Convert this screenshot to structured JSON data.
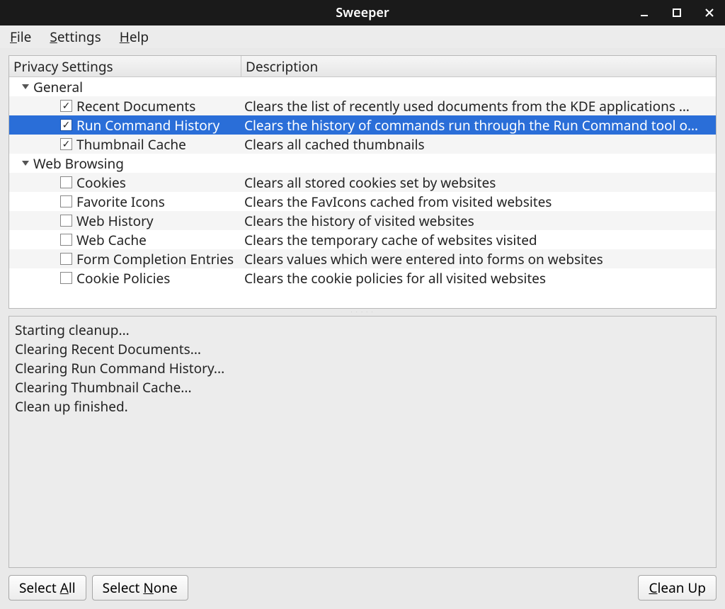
{
  "window": {
    "title": "Sweeper"
  },
  "menubar": {
    "file": "File",
    "settings": "Settings",
    "help": "Help"
  },
  "columns": {
    "col1": "Privacy Settings",
    "col2": "Description"
  },
  "groups": [
    {
      "name": "General",
      "items": [
        {
          "label": "Recent Documents",
          "checked": true,
          "selected": false,
          "desc": "Clears the list of recently used documents from the KDE applications …"
        },
        {
          "label": "Run Command History",
          "checked": true,
          "selected": true,
          "desc": "Clears the history of commands run through the Run Command tool o…"
        },
        {
          "label": "Thumbnail Cache",
          "checked": true,
          "selected": false,
          "desc": "Clears all cached thumbnails"
        }
      ]
    },
    {
      "name": "Web Browsing",
      "items": [
        {
          "label": "Cookies",
          "checked": false,
          "selected": false,
          "desc": "Clears all stored cookies set by websites"
        },
        {
          "label": "Favorite Icons",
          "checked": false,
          "selected": false,
          "desc": "Clears the FavIcons cached from visited websites"
        },
        {
          "label": "Web History",
          "checked": false,
          "selected": false,
          "desc": "Clears the history of visited websites"
        },
        {
          "label": "Web Cache",
          "checked": false,
          "selected": false,
          "desc": "Clears the temporary cache of websites visited"
        },
        {
          "label": "Form Completion Entries",
          "checked": false,
          "selected": false,
          "desc": "Clears values which were entered into forms on websites"
        },
        {
          "label": "Cookie Policies",
          "checked": false,
          "selected": false,
          "desc": "Clears the cookie policies for all visited websites"
        }
      ]
    }
  ],
  "log": [
    "Starting cleanup...",
    "Clearing Recent Documents...",
    "Clearing Run Command History...",
    "Clearing Thumbnail Cache...",
    "Clean up finished."
  ],
  "buttons": {
    "select_all": "Select All",
    "select_none": "Select None",
    "clean_up": "Clean Up"
  }
}
